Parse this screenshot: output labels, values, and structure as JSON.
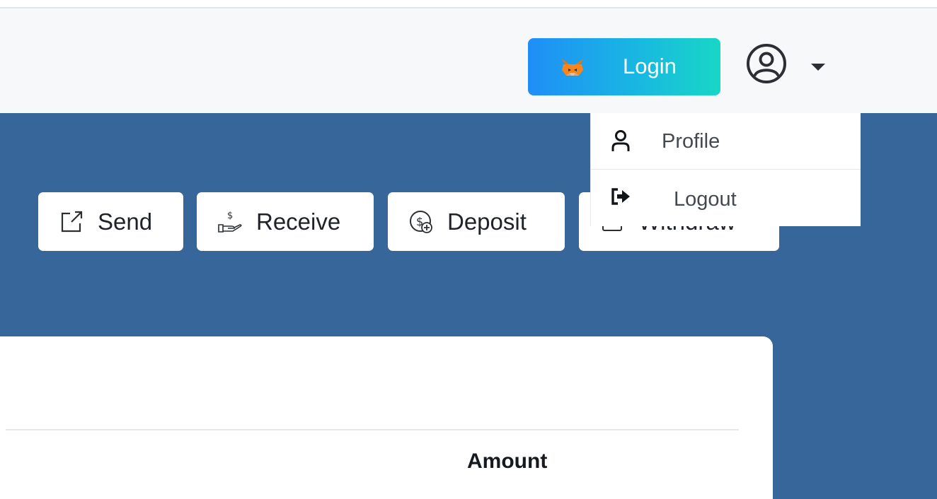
{
  "header": {
    "login_label": "Login",
    "login_icon": "metamask-fox-icon",
    "user_icon": "user-circle-icon",
    "caret_icon": "caret-down-icon"
  },
  "user_menu": {
    "items": [
      {
        "label": "Profile",
        "icon": "user-icon"
      },
      {
        "label": "Logout",
        "icon": "sign-out-icon"
      }
    ]
  },
  "actions": [
    {
      "label": "Send",
      "icon": "external-link-icon"
    },
    {
      "label": "Receive",
      "icon": "hand-dollar-icon"
    },
    {
      "label": "Deposit",
      "icon": "coin-plus-icon"
    },
    {
      "label": "Withdraw",
      "icon": "wallet-icon"
    }
  ],
  "table": {
    "columns": [
      "Amount"
    ]
  },
  "colors": {
    "banner": "#37669a",
    "navbar": "#f7f8f9",
    "login_gradient_start": "#1f8ef7",
    "login_gradient_end": "#18d7c6"
  }
}
